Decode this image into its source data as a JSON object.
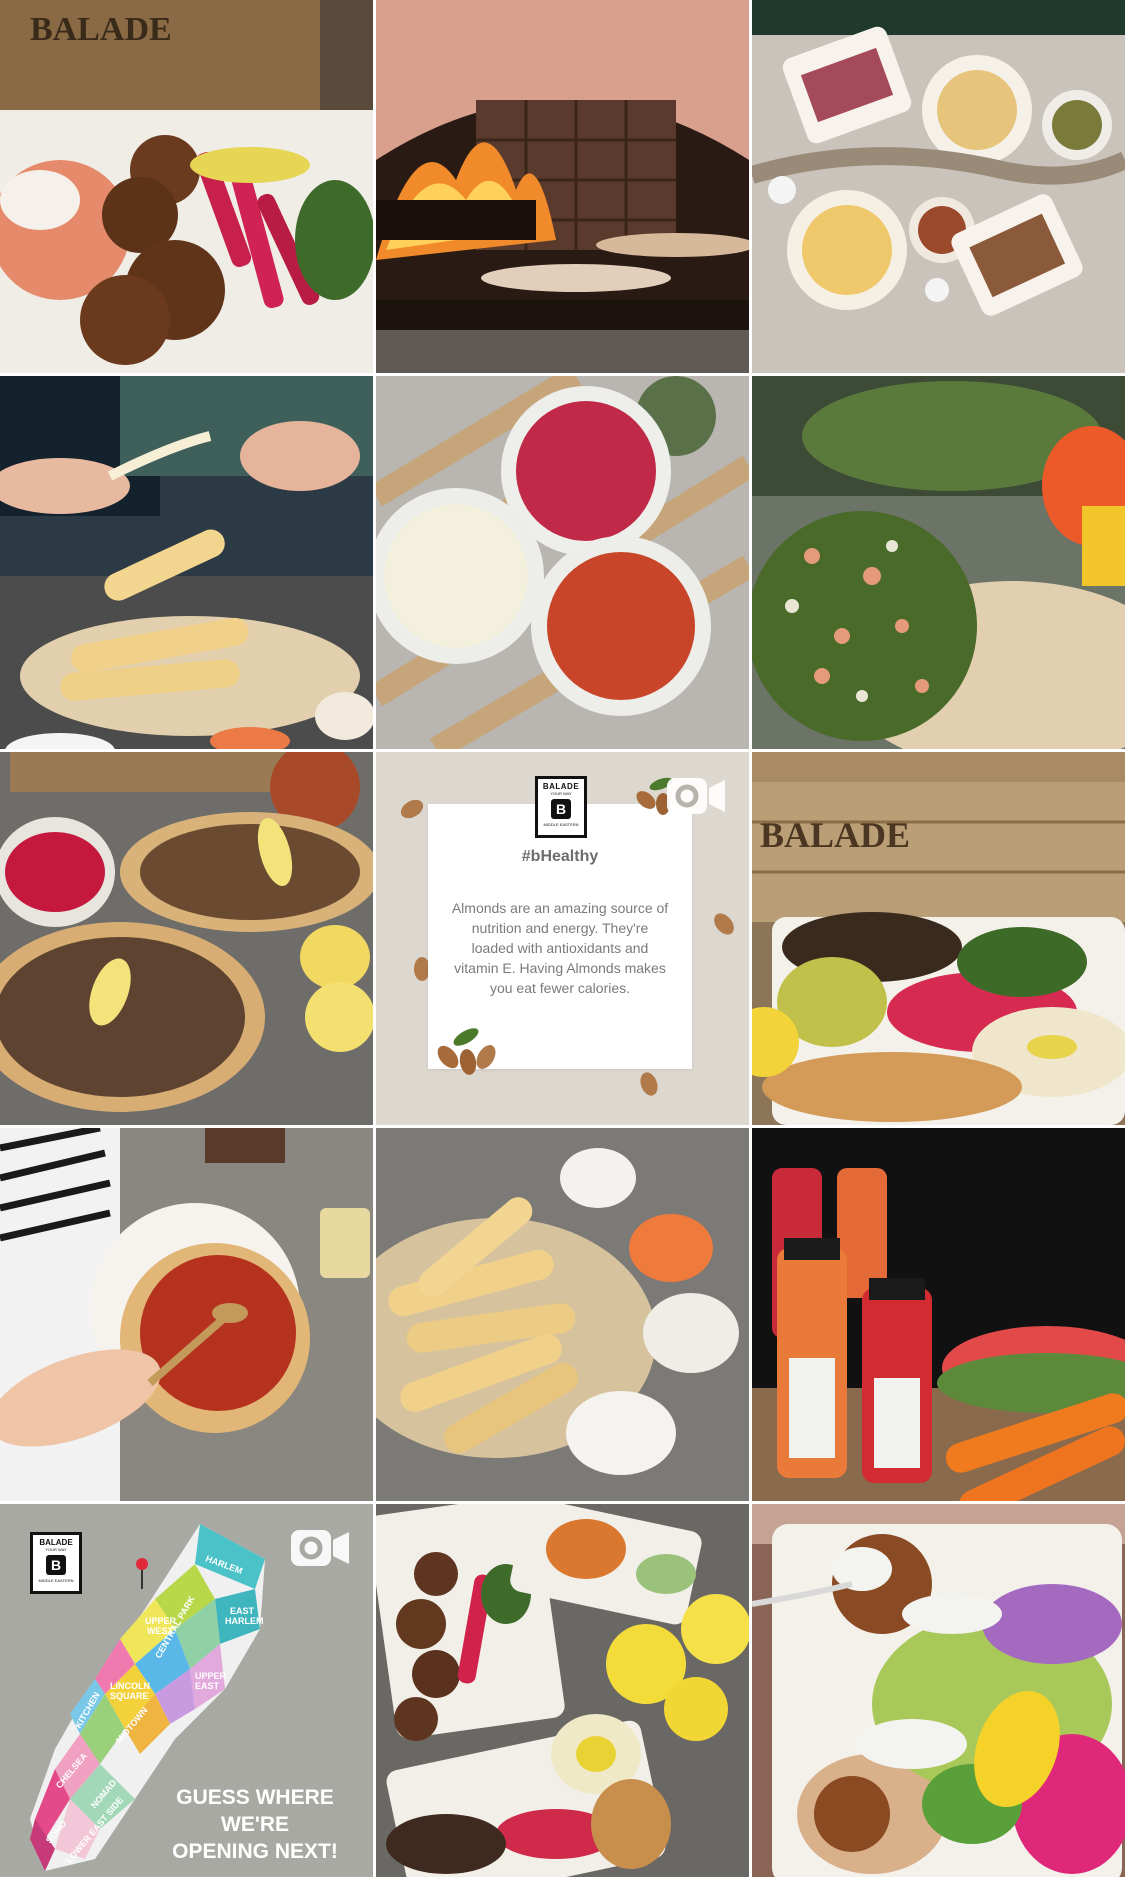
{
  "feed": {
    "tiles": [
      {
        "alt": "Falafel platter with tomatoes, feta and pickled turnips",
        "type": "photo"
      },
      {
        "alt": "Wood-fired oven baking flatbread",
        "type": "photo"
      },
      {
        "alt": "Spread of Middle Eastern dishes on a table",
        "type": "photo"
      },
      {
        "alt": "Cheese rolls being pulled apart",
        "type": "photo"
      },
      {
        "alt": "Three dips in plastic tubs",
        "type": "photo"
      },
      {
        "alt": "Tabbouleh salad on a plate",
        "type": "photo"
      },
      {
        "alt": "Lahm bi ajeen flatbreads with lemon",
        "type": "photo"
      },
      {
        "alt": "bHealthy almonds tip card",
        "type": "video"
      },
      {
        "alt": "Balade bowl with meat, pickles and hummus",
        "type": "photo"
      },
      {
        "alt": "Spreading tomato topping on flatbread",
        "type": "photo"
      },
      {
        "alt": "Cheese rolls with dipping sauces",
        "type": "photo"
      },
      {
        "alt": "Bottled juices with watermelon and carrots",
        "type": "photo"
      },
      {
        "alt": "Manhattan map announcing new location",
        "type": "video"
      },
      {
        "alt": "Two bowls of falafel and chicken with lemons",
        "type": "photo"
      },
      {
        "alt": "Falafel bowl with salad held by a spoon",
        "type": "photo"
      }
    ]
  },
  "tip_card": {
    "logo_brand": "BALADE",
    "logo_sub": "YOUR WAY",
    "logo_mark": "B",
    "logo_foot": "MIDDLE EASTERN",
    "title": "#bHealthy",
    "body": "Almonds are an amazing source of nutrition and energy. They're loaded with antioxidants and vitamin E. Having Almonds makes you eat fewer calories."
  },
  "wall_sign": {
    "text_top": "BALADE",
    "text_mid": "BALADE"
  },
  "map_card": {
    "logo_brand": "BALADE",
    "logo_sub": "YOUR WAY",
    "logo_mark": "B",
    "logo_foot": "MIDDLE EASTERN",
    "headline_line1": "GUESS WHERE",
    "headline_line2": "WE'RE",
    "headline_line3": "OPENING NEXT!",
    "neighborhoods": [
      "HARLEM",
      "EAST HARLEM",
      "UPPER WEST SIDE",
      "CENTRAL PARK",
      "UPPER EAST SIDE",
      "LINCOLN SQUARE",
      "LENOX HILL",
      "HELL'S KITCHEN",
      "MIDTOWN",
      "CHELSEA",
      "NOMAD",
      "SOHO",
      "TRIBECA",
      "LOWER EAST SIDE"
    ]
  },
  "icons": {
    "video_badge": "video-camera-icon"
  },
  "colors": {
    "tip_bg": "#dcd7cf",
    "map_bg": "#a9a9a4",
    "headline": "#ffffff"
  }
}
